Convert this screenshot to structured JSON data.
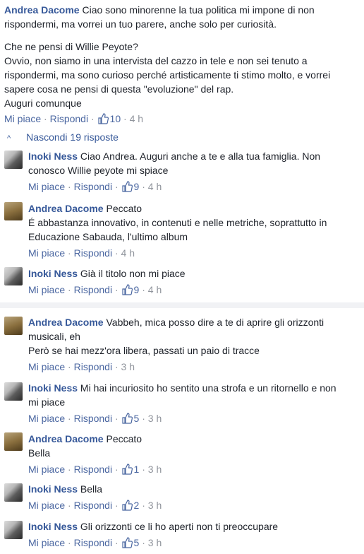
{
  "main": {
    "name": "Andrea Dacome",
    "lines": [
      "Ciao sono minorenne la tua politica mi impone di non",
      "rispondermi, ma vorrei un tuo parere, anche solo per curiosità."
    ],
    "paragraph2": [
      "Che ne pensi di Willie Peyote?",
      "Ovvio, non siamo in una intervista del cazzo in tele e non sei tenuto a",
      "rispondermi, ma sono curioso perché artisticamente ti stimo molto, e vorrei",
      "sapere cosa ne pensi di questa \"evoluzione\" del rap.",
      "Auguri comunque"
    ],
    "like": "Mi piace",
    "reply": "Rispondi",
    "likes": "10",
    "time": "4 h"
  },
  "hide_replies": "Nascondi 19 risposte",
  "replies": [
    {
      "name": "Inoki Ness",
      "text": "Ciao Andrea. Auguri anche a te e alla tua famiglia. Non",
      "text2": "conosco Willie peyote mi spiace",
      "like": "Mi piace",
      "reply": "Rispondi",
      "likes": "9",
      "time": "4 h"
    },
    {
      "name": "Andrea Dacome",
      "text": "Peccato",
      "text2": "É abbastanza innovativo, in contenuti e nelle metriche, soprattutto in",
      "text3": "Educazione Sabauda, l'ultimo album",
      "like": "Mi piace",
      "reply": "Rispondi",
      "time": "4 h"
    },
    {
      "name": "Inoki Ness",
      "text": "Già il titolo non mi piace",
      "like": "Mi piace",
      "reply": "Rispondi",
      "likes": "9",
      "time": "4 h"
    },
    {
      "name": "Andrea Dacome",
      "text": "Vabbeh, mica posso dire a te di aprire gli orizzonti",
      "text2": "musicali, eh",
      "text3": "Però se hai mezz'ora libera, passati un paio di tracce",
      "like": "Mi piace",
      "reply": "Rispondi",
      "time": "3 h"
    },
    {
      "name": "Inoki Ness",
      "text": "Mi hai incuriosito ho sentito una strofa e un ritornello e non",
      "text2": "mi piace",
      "like": "Mi piace",
      "reply": "Rispondi",
      "likes": "5",
      "time": "3 h"
    },
    {
      "name": "Andrea Dacome",
      "text": "Peccato",
      "text2": "Bella",
      "like": "Mi piace",
      "reply": "Rispondi",
      "likes": "1",
      "time": "3 h"
    },
    {
      "name": "Inoki Ness",
      "text": "Bella",
      "like": "Mi piace",
      "reply": "Rispondi",
      "likes": "2",
      "time": "3 h"
    },
    {
      "name": "Inoki Ness",
      "text": "Gli orizzonti ce li ho aperti non ti preoccupare",
      "like": "Mi piace",
      "reply": "Rispondi",
      "likes": "5",
      "time": "3 h"
    }
  ],
  "sep": "·",
  "icons": {
    "like": "thumbs-up-icon",
    "caret": "chevron-up-icon"
  },
  "colors": {
    "link": "#365899",
    "meta": "#90949c",
    "divider": "#f1f2f5"
  }
}
